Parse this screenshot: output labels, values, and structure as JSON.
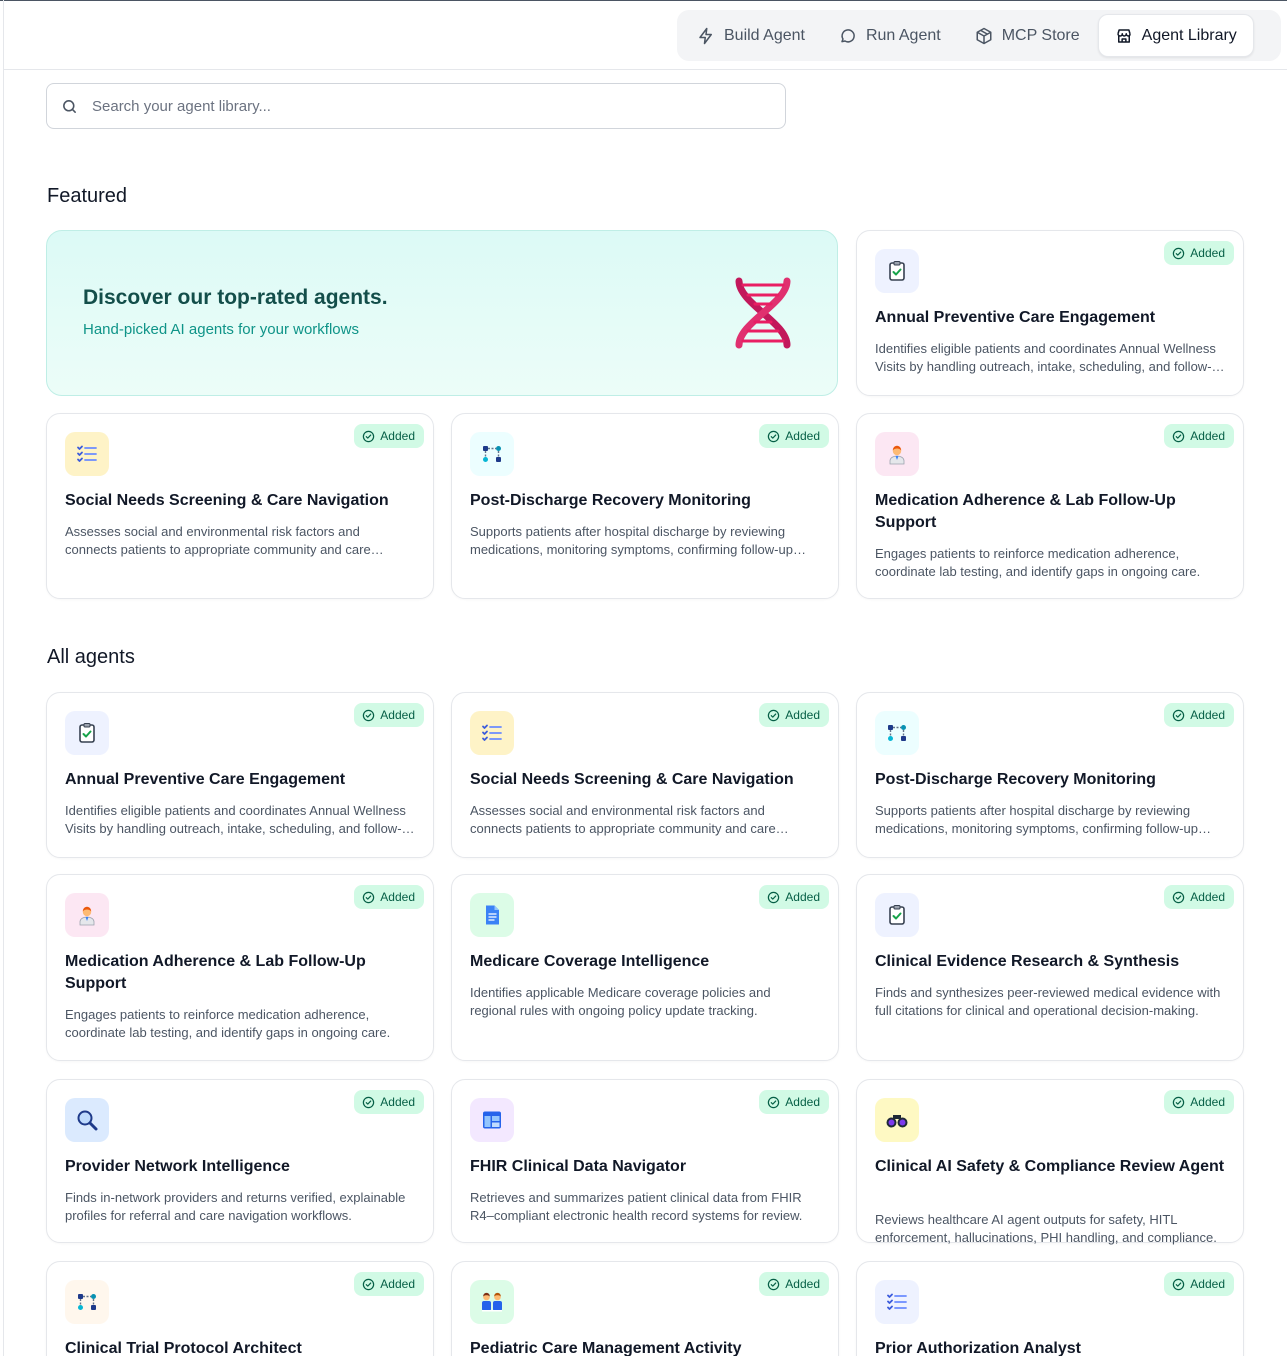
{
  "nav": {
    "tabs": [
      {
        "label": "Build Agent",
        "icon": "lightning-icon",
        "active": false
      },
      {
        "label": "Run Agent",
        "icon": "chat-bubble-icon",
        "active": false
      },
      {
        "label": "MCP Store",
        "icon": "package-icon",
        "active": false
      },
      {
        "label": "Agent Library",
        "icon": "store-icon",
        "active": true
      }
    ]
  },
  "search": {
    "placeholder": "Search your agent library..."
  },
  "featured": {
    "title": "Featured",
    "hero": {
      "title": "Discover our top-rated agents.",
      "subtitle": "Hand-picked AI agents for your workflows",
      "icon": "dna-icon"
    },
    "cards": [
      {
        "title": "Annual Preventive Care Engagement",
        "description": "Identifies eligible patients and coordinates Annual Wellness Visits by handling outreach, intake, scheduling, and follow-up.",
        "badge": "Added",
        "icon": "clipboard-check-icon"
      },
      {
        "title": "Social Needs Screening & Care Navigation",
        "description": "Assesses social and environmental risk factors and connects patients to appropriate community and care resources.",
        "badge": "Added",
        "icon": "checklist-icon"
      },
      {
        "title": "Post-Discharge Recovery Monitoring",
        "description": "Supports patients after hospital discharge by reviewing medications, monitoring symptoms, confirming follow-up care.",
        "badge": "Added",
        "icon": "workflow-icon"
      },
      {
        "title": "Medication Adherence & Lab Follow-Up Support",
        "description": "Engages patients to reinforce medication adherence, coordinate lab testing, and identify gaps in ongoing care.",
        "badge": "Added",
        "icon": "doctor-icon"
      }
    ]
  },
  "all_agents": {
    "title": "All agents",
    "cards": [
      {
        "title": "Annual Preventive Care Engagement",
        "description": "Identifies eligible patients and coordinates Annual Wellness Visits by handling outreach, intake, scheduling, and follow-up.",
        "badge": "Added",
        "icon": "clipboard-check-icon"
      },
      {
        "title": "Social Needs Screening & Care Navigation",
        "description": "Assesses social and environmental risk factors and connects patients to appropriate community and care resources.",
        "badge": "Added",
        "icon": "checklist-icon"
      },
      {
        "title": "Post-Discharge Recovery Monitoring",
        "description": "Supports patients after hospital discharge by reviewing medications, monitoring symptoms, confirming follow-up care.",
        "badge": "Added",
        "icon": "workflow-icon"
      },
      {
        "title": "Medication Adherence & Lab Follow-Up Support",
        "description": "Engages patients to reinforce medication adherence, coordinate lab testing, and identify gaps in ongoing care.",
        "badge": "Added",
        "icon": "doctor-icon"
      },
      {
        "title": "Medicare Coverage Intelligence",
        "description": "Identifies applicable Medicare coverage policies and regional rules with ongoing policy update tracking.",
        "badge": "Added",
        "icon": "document-icon"
      },
      {
        "title": "Clinical Evidence Research & Synthesis",
        "description": "Finds and synthesizes peer-reviewed medical evidence with full citations for clinical and operational decision-making.",
        "badge": "Added",
        "icon": "clipboard-check-icon"
      },
      {
        "title": "Provider Network Intelligence",
        "description": "Finds in-network providers and returns verified, explainable profiles for referral and care navigation workflows.",
        "badge": "Added",
        "icon": "magnifier-icon"
      },
      {
        "title": "FHIR Clinical Data Navigator",
        "description": "Retrieves and summarizes patient clinical data from FHIR R4–compliant electronic health record systems for review.",
        "badge": "Added",
        "icon": "layout-window-icon"
      },
      {
        "title": "Clinical AI Safety & Compliance Review Agent",
        "description": "Reviews healthcare AI agent outputs for safety, HITL enforcement, hallucinations, PHI handling, and compliance.",
        "badge": "Added",
        "icon": "binoculars-icon"
      },
      {
        "title": "Clinical Trial Protocol Architect",
        "description": "",
        "badge": "Added",
        "icon": "workflow-icon"
      },
      {
        "title": "Pediatric Care Management Activity",
        "description": "",
        "badge": "Added",
        "icon": "family-icon"
      },
      {
        "title": "Prior Authorization Analyst",
        "description": "",
        "badge": "Added",
        "icon": "checklist-icon"
      }
    ]
  }
}
